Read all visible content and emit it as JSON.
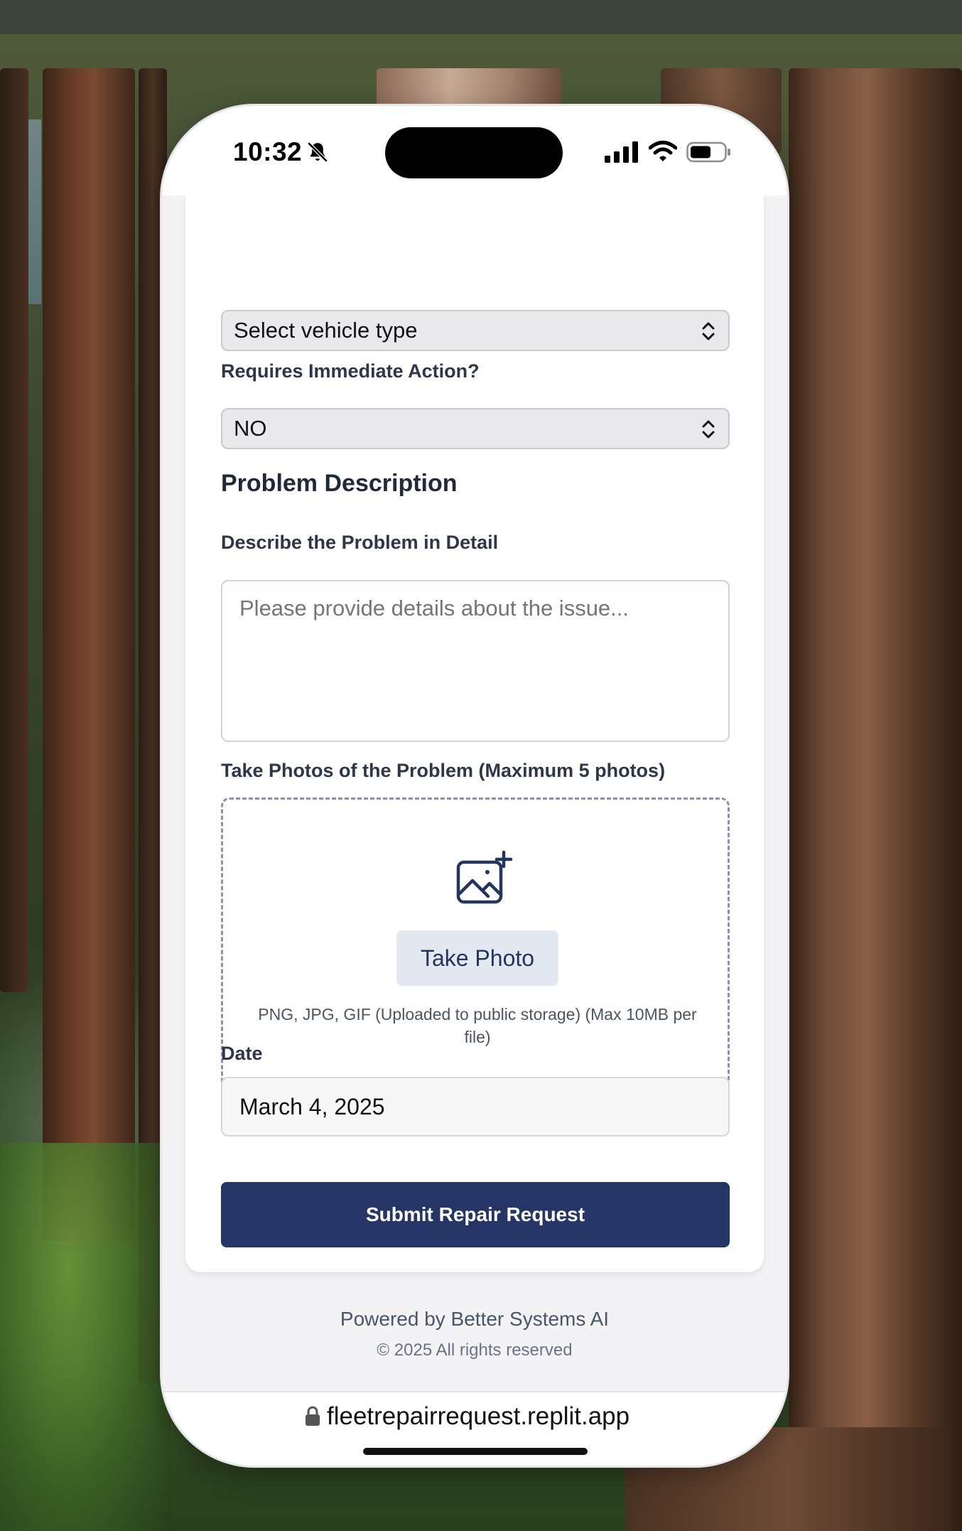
{
  "status_bar": {
    "time": "10:32",
    "icons": [
      "bell-slash-icon",
      "signal-icon",
      "wifi-icon",
      "battery-icon"
    ]
  },
  "form": {
    "vehicle_type": {
      "selected": "Select vehicle type"
    },
    "immediate_action": {
      "label": "Requires Immediate Action?",
      "selected": "NO"
    },
    "section_title": "Problem Description",
    "describe": {
      "label": "Describe the Problem in Detail",
      "placeholder": "Please provide details about the issue..."
    },
    "photos": {
      "label": "Take Photos of the Problem (Maximum 5 photos)",
      "icon": "add-image-icon",
      "button_label": "Take Photo",
      "note": "PNG, JPG, GIF (Uploaded to public storage) (Max 10MB per file)"
    },
    "date": {
      "label": "Date",
      "value": "March 4, 2025"
    },
    "submit_label": "Submit Repair Request"
  },
  "footer": {
    "powered_by": "Powered by Better Systems AI",
    "rights": "© 2025 All rights reserved"
  },
  "browser": {
    "url": "fleetrepairrequest.replit.app",
    "icon": "lock-icon"
  },
  "colors": {
    "accent": "#253565",
    "button_secondary": "#e4e8f1",
    "label_text": "#2d3748",
    "page_bg": "#f3f3f6"
  }
}
